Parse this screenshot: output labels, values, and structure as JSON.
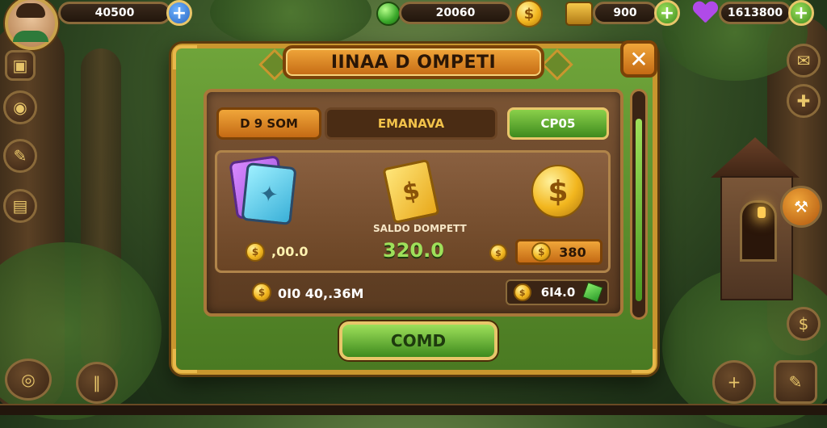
{
  "top_bar": {
    "gold": "40500",
    "gems": "20060",
    "chests": "900",
    "hearts": "1613800"
  },
  "dialog": {
    "title": "IINAA D OMPETI",
    "close_label": "✕",
    "tabs": [
      {
        "label": "D 9 SOM"
      },
      {
        "label": "EMANAVA"
      },
      {
        "label": "CP05"
      }
    ],
    "saldo_label": "SALDO DOMPETT",
    "saldo_value": "320.0",
    "left_value": ",00.0",
    "right_value": "380",
    "row_left_value": "0I0 40,.36M",
    "row_right_value": "6I4.0",
    "confirm_label": "COMD"
  },
  "colors": {
    "accent_gold": "#c9962e",
    "panel_green": "#6fa43a",
    "button_green": "#3e8a1e",
    "title_orange": "#f0a63a"
  }
}
